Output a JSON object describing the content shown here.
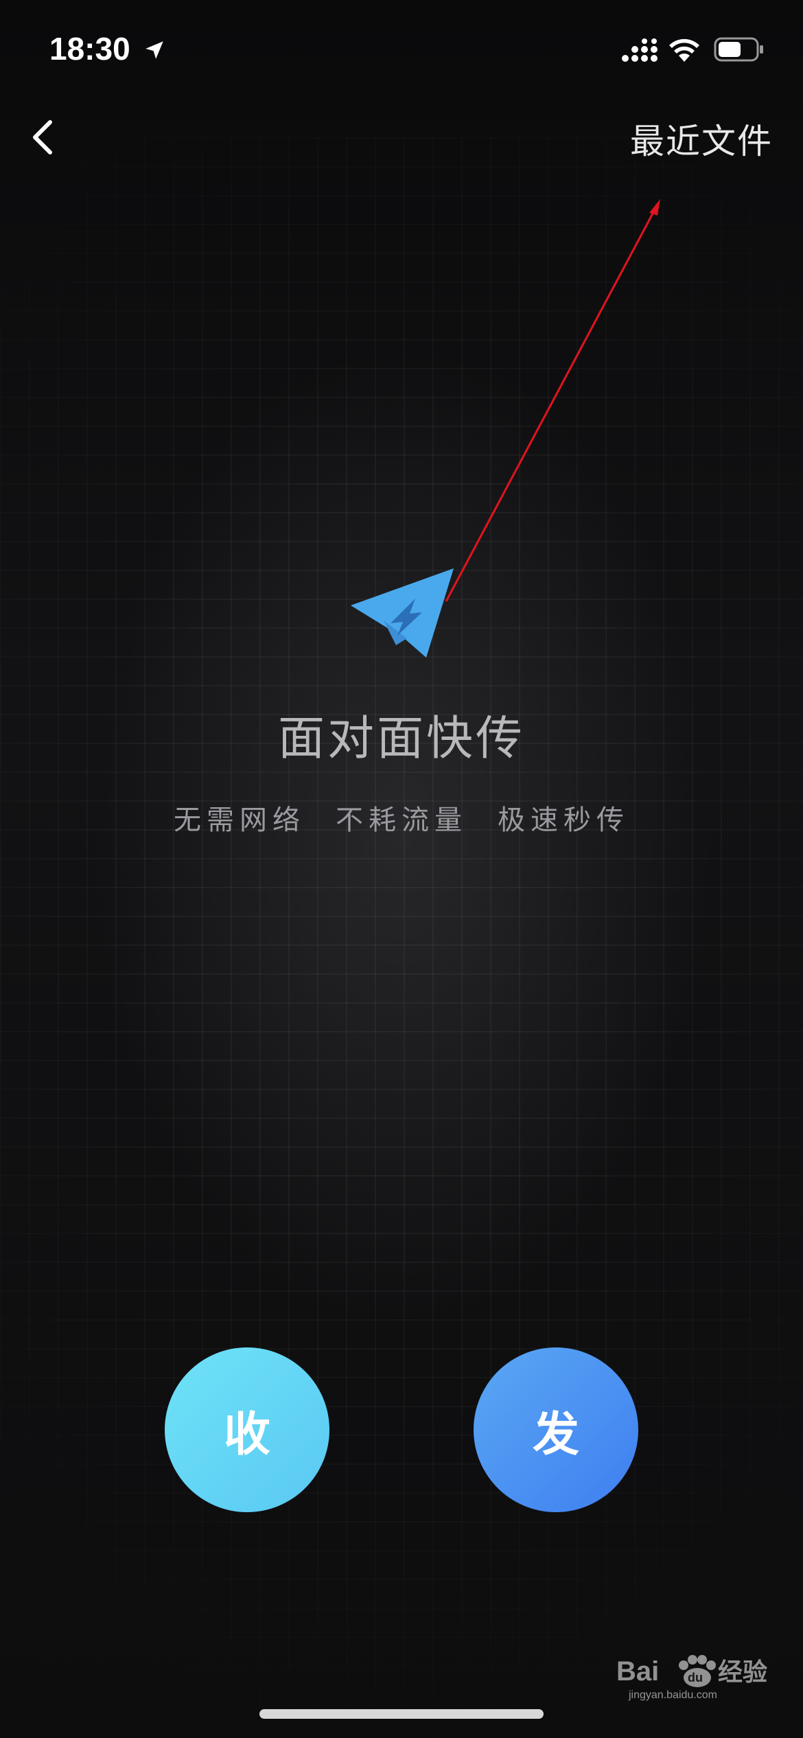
{
  "status_bar": {
    "time": "18:30",
    "icons": [
      "location-arrow-icon",
      "signal-icon",
      "wifi-icon",
      "battery-icon"
    ]
  },
  "nav": {
    "back_icon": "chevron-left-icon",
    "recent_files_label": "最近文件"
  },
  "main": {
    "logo_icon": "paper-plane-lightning-icon",
    "title": "面对面快传",
    "features": [
      "无需网络",
      "不耗流量",
      "极速秒传"
    ]
  },
  "actions": {
    "receive_label": "收",
    "send_label": "发"
  },
  "watermark": {
    "text": "Bai du 经验",
    "url": "jingyan.baidu.com"
  },
  "colors": {
    "background": "#0d0d0e",
    "title": "#b8b8bc",
    "receive_button": "#64d5f5",
    "send_button": "#4a90f2",
    "logo_blue": "#4aa9ec",
    "annotation_arrow": "#e0141e"
  }
}
